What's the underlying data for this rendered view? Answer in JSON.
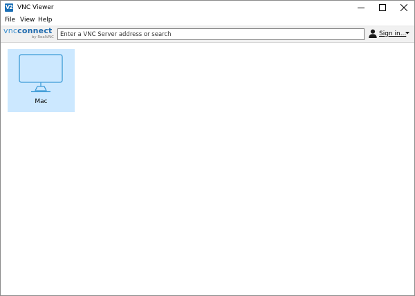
{
  "window": {
    "title": "VNC Viewer",
    "app_icon_text": "V2"
  },
  "menu": {
    "file": "File",
    "view": "View",
    "help": "Help"
  },
  "toolbar": {
    "logo_vnc": "vnc",
    "logo_connect": "connect",
    "logo_by": "by RealVNC",
    "search_placeholder": "Enter a VNC Server address or search",
    "search_value": "",
    "signin_label": "Sign in...",
    "signin_icon": "user-icon",
    "dropdown_icon": "chevron-down-icon"
  },
  "connections": [
    {
      "label": "Mac",
      "icon": "monitor-icon",
      "selected": true
    }
  ],
  "colors": {
    "accent": "#1d69ad",
    "selection": "#cce8ff",
    "monitor_stroke": "#3c9ad6"
  }
}
